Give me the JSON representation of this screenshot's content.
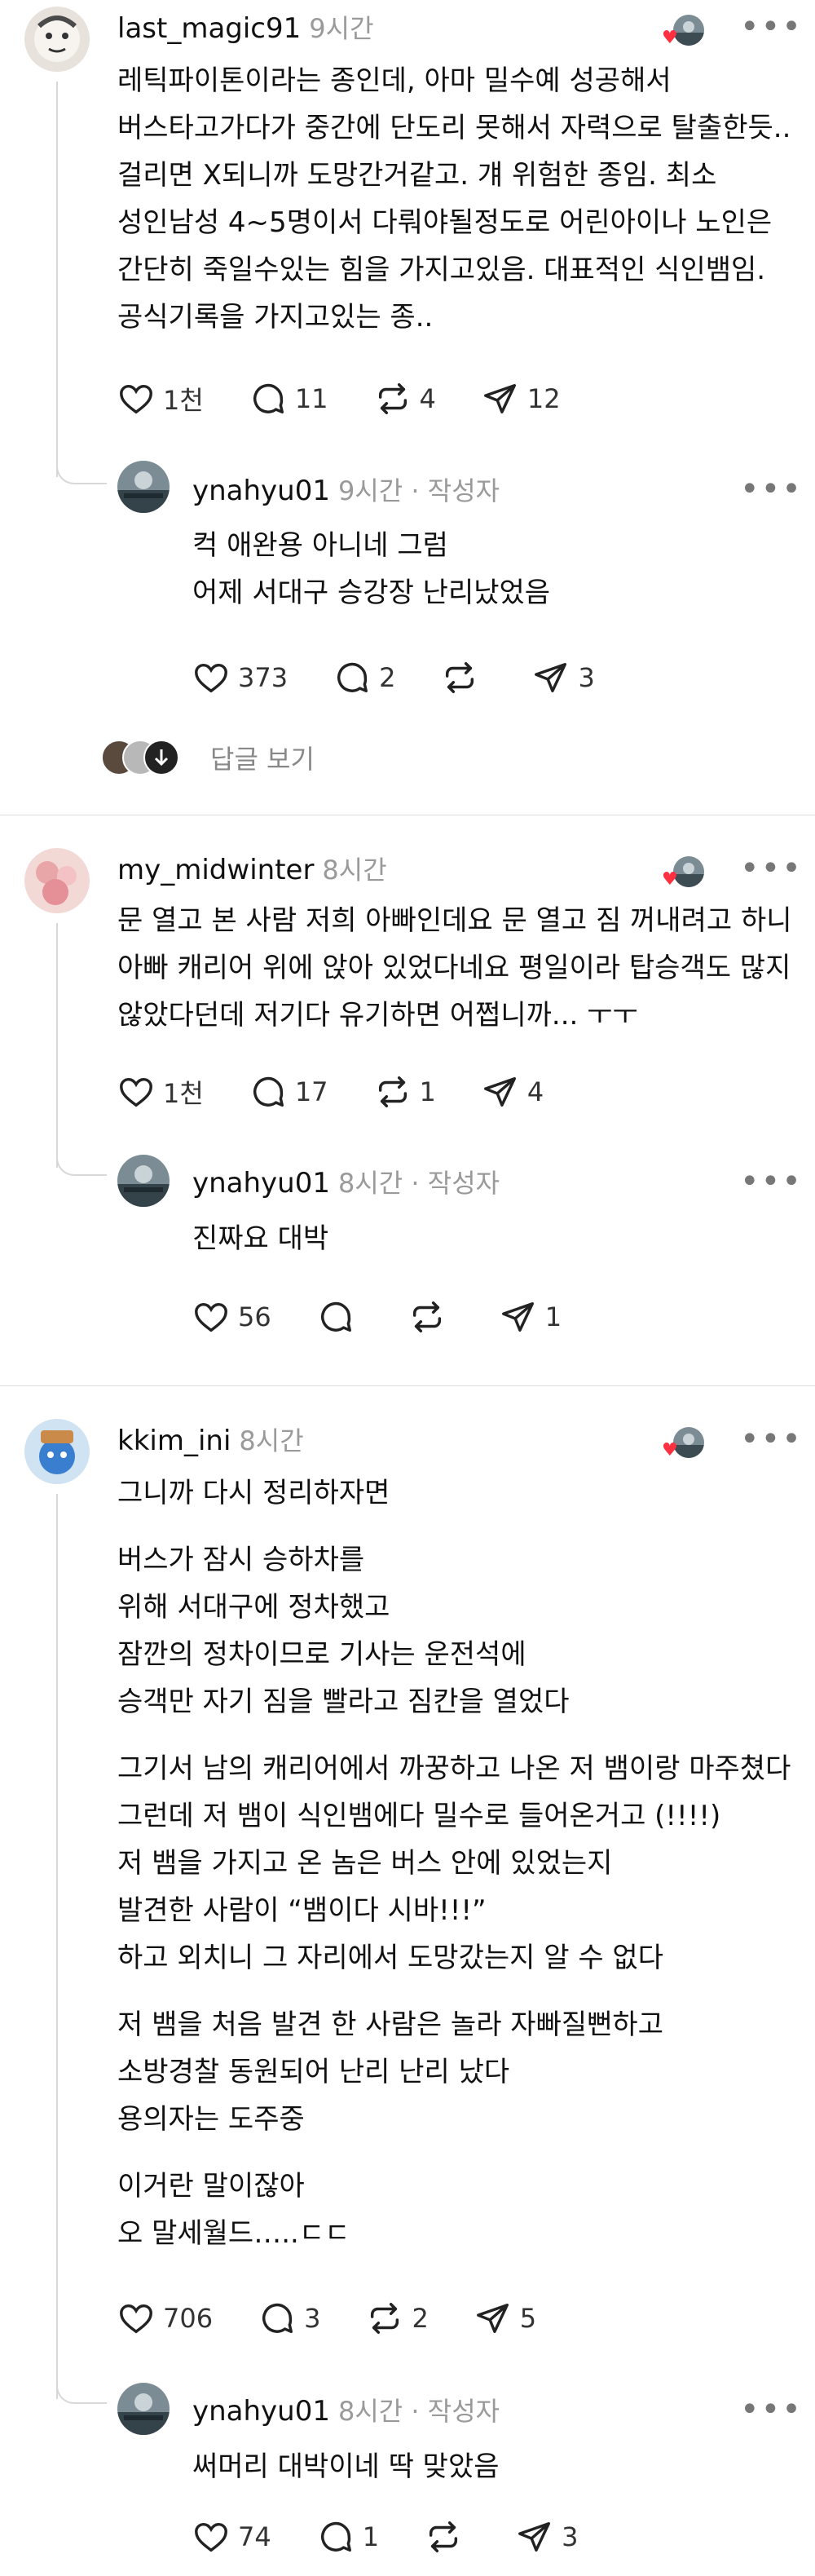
{
  "threads": [
    {
      "comment": {
        "username": "last_magic91",
        "time": "9시간",
        "lines": [
          "레틱파이톤이라는 종인데, 아마 밀수예 성공해서",
          "버스타고가다가 중간에 단도리 못해서 자력으로 탈출한듯..",
          "걸리면 X되니까 도망간거같고. 걔 위험한 종임. 최소",
          "성인남성 4~5명이서 다뤄야될정도로 어린아이나 노인은",
          "간단히 죽일수있는 힘을 가지고있음. 대표적인 식인뱀임.",
          "공식기록을 가지고있는 종.."
        ],
        "likes": "1천",
        "replies": "11",
        "reposts": "4",
        "shares": "12"
      },
      "reply": {
        "username": "ynahyu01",
        "time": "9시간 · 작성자",
        "lines": [
          "컥 애완용 아니네 그럼",
          "어제 서대구 승강장 난리났었음"
        ],
        "likes": "373",
        "replies": "2",
        "reposts": "",
        "shares": "3"
      },
      "view_replies": "답글 보기"
    },
    {
      "comment": {
        "username": "my_midwinter",
        "time": "8시간",
        "lines": [
          "문 열고 본 사람 저희 아빠인데요 문 열고 짐 꺼내려고 하니",
          "아빠 캐리어 위에 앉아 있었다네요 평일이라 탑승객도 많지",
          "않았다던데 저기다 유기하면 어쩝니까... ㅜㅜ"
        ],
        "likes": "1천",
        "replies": "17",
        "reposts": "1",
        "shares": "4"
      },
      "reply": {
        "username": "ynahyu01",
        "time": "8시간 · 작성자",
        "lines": [
          "진짜요 대박"
        ],
        "likes": "56",
        "replies": "",
        "reposts": "",
        "shares": "1"
      }
    },
    {
      "comment": {
        "username": "kkim_ini",
        "time": "8시간",
        "paragraphs": [
          [
            "그니까 다시 정리하자면"
          ],
          [
            "버스가 잠시 승하차를",
            "위해 서대구에 정차했고",
            "잠깐의 정차이므로 기사는 운전석에",
            "승객만 자기 짐을 빨라고 짐칸을 열었다"
          ],
          [
            "그기서 남의 캐리어에서 까꿍하고 나온 저 뱀이랑 마주쳤다",
            "그런데 저 뱀이 식인뱀에다 밀수로 들어온거고 (!!!!)",
            "저 뱀을 가지고 온 놈은 버스 안에 있었는지",
            "발견한 사람이 “뱀이다 시바!!!”",
            "하고 외치니 그 자리에서 도망갔는지 알 수 없다"
          ],
          [
            "저 뱀을 처음 발견 한 사람은 놀라 자빠질뻔하고",
            "소방경찰 동원되어 난리 난리 났다",
            "용의자는 도주중"
          ],
          [
            "이거란 말이잖아",
            "오 말세월드…..ㄷㄷ"
          ]
        ],
        "likes": "706",
        "replies": "3",
        "reposts": "2",
        "shares": "5"
      },
      "reply": {
        "username": "ynahyu01",
        "time": "8시간 · 작성자",
        "lines": [
          "써머리 대박이네 딱 맞았음"
        ],
        "likes": "74",
        "replies": "1",
        "reposts": "",
        "shares": "3"
      }
    }
  ],
  "more_label": "•••",
  "icons": [
    "heart-icon",
    "comment-icon",
    "repost-icon",
    "share-icon",
    "more-icon"
  ],
  "colors": {
    "accent_heart": "#ff3040",
    "muted": "#9a9a9a",
    "divider": "#dcdcdc"
  }
}
